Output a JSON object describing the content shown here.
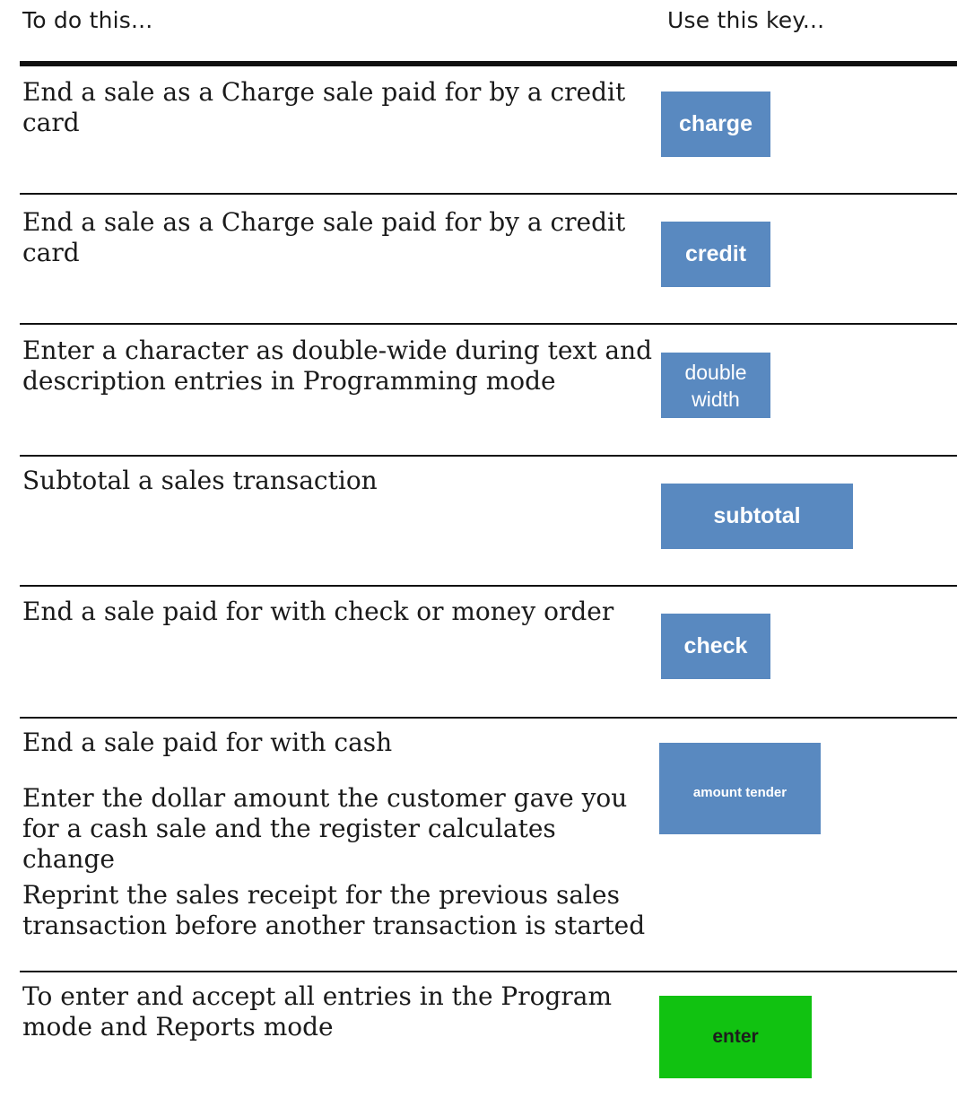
{
  "header": {
    "left_label": "To do this...",
    "right_label": "Use this key..."
  },
  "rows": [
    {
      "description": "End a sale as a Charge sale paid for by a credit card",
      "key_label": "charge",
      "key_color": "#5989c0"
    },
    {
      "description": "End a sale as a Charge sale paid for by a credit card",
      "key_label": "credit",
      "key_color": "#5989c0"
    },
    {
      "description": "Enter a character as double-wide during text and description entries in Programming mode",
      "key_label_line1": "double",
      "key_label_line2": "width",
      "key_color": "#5989c0"
    },
    {
      "description": "Subtotal a sales transaction",
      "key_label": "subtotal",
      "key_color": "#5989c0"
    },
    {
      "description": "End a sale paid for with check or money order",
      "key_label": "check",
      "key_color": "#5989c0"
    },
    {
      "descriptions": [
        "End a sale paid for with cash",
        "Enter the dollar amount the customer gave you for a cash sale and the register calculates change",
        "Reprint the sales receipt for the previous sales transaction before another transaction is started"
      ],
      "key_label": "amount tender",
      "key_color": "#5989c0"
    },
    {
      "description": "To enter and accept all entries in the Program mode and Reports mode",
      "key_label": "enter",
      "key_color": "#11c211"
    }
  ]
}
